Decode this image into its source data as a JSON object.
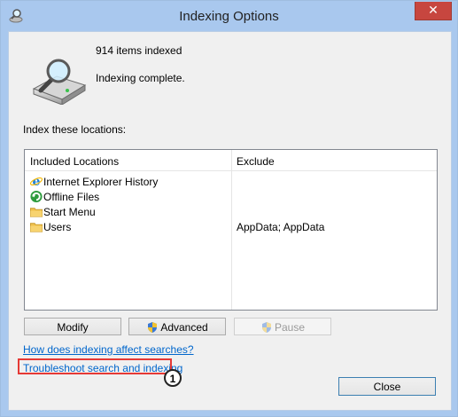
{
  "window": {
    "title": "Indexing Options"
  },
  "summary": {
    "items_count": "914 items indexed",
    "status": "Indexing complete."
  },
  "locations": {
    "label": "Index these locations:",
    "columns": [
      "Included Locations",
      "Exclude"
    ],
    "rows": [
      {
        "icon": "internet-explorer-icon",
        "name": "Internet Explorer History",
        "exclude": ""
      },
      {
        "icon": "outlook-offline-files-icon",
        "name": "Offline Files",
        "exclude": ""
      },
      {
        "icon": "folder-icon",
        "name": "Start Menu",
        "exclude": ""
      },
      {
        "icon": "folder-icon",
        "name": "Users",
        "exclude": "AppData; AppData"
      }
    ]
  },
  "buttons": {
    "modify": "Modify",
    "advanced": "Advanced",
    "pause": "Pause",
    "close": "Close"
  },
  "links": {
    "how": "How does indexing affect searches?",
    "troubleshoot": "Troubleshoot search and indexing"
  },
  "annotation": {
    "number": "1",
    "color": "#e53935"
  },
  "colors": {
    "titlebar": "#a9c8ee",
    "close_button": "#c7463f",
    "link": "#0066cc"
  }
}
